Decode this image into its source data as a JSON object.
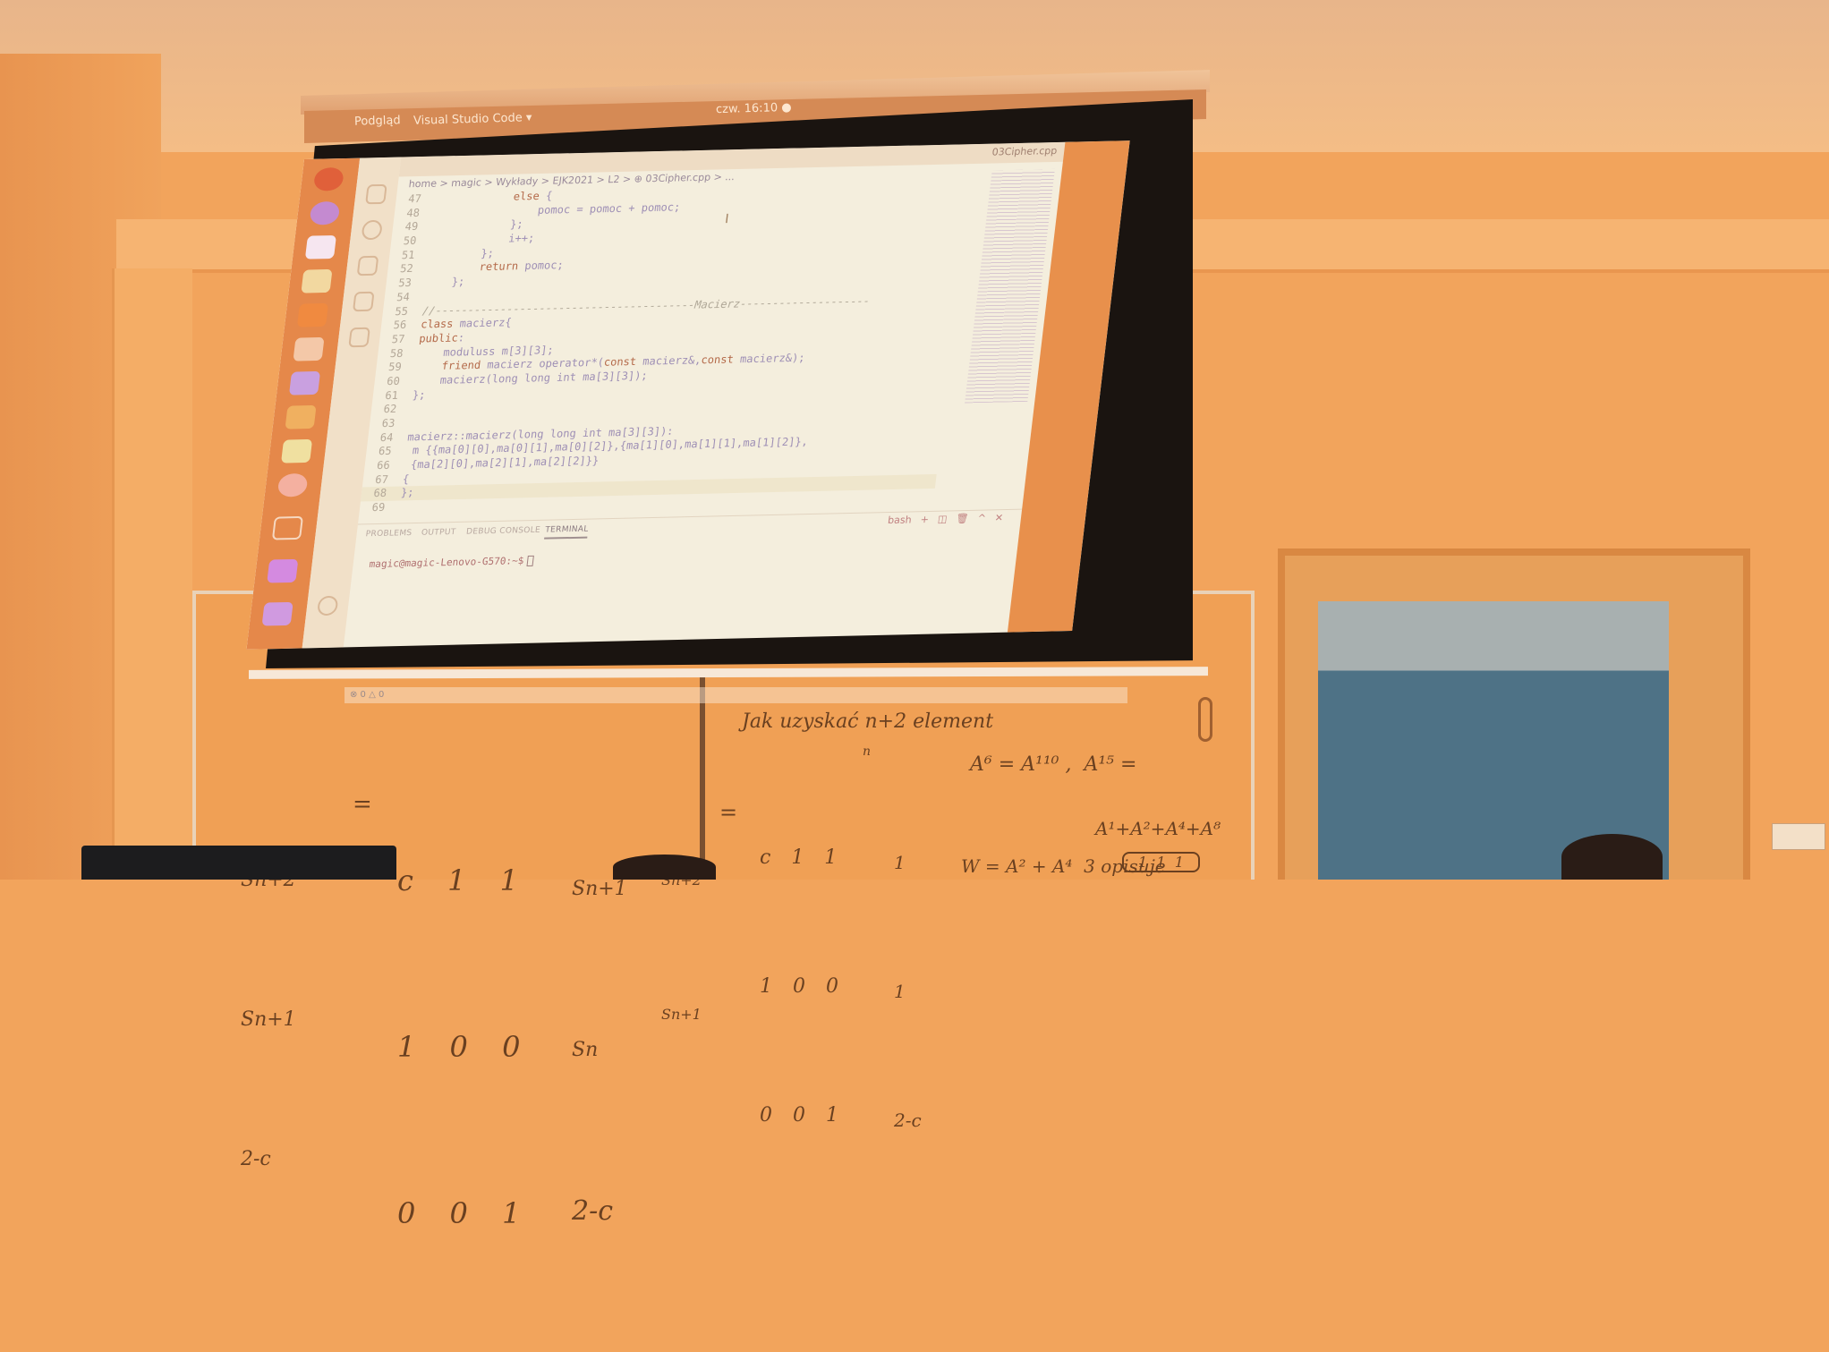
{
  "topbar": {
    "activities": "Podgląd",
    "app": "Visual Studio Code ▾",
    "clock": "czw. 16:10 ●"
  },
  "editor": {
    "tab_title": "03Cipher.cpp",
    "breadcrumb": "home > magic > Wykłady > EJK2021 > L2 > ⊕ 03Cipher.cpp > ...",
    "lines": [
      {
        "n": "47",
        "t": "            else {"
      },
      {
        "n": "48",
        "t": "                pomoc = pomoc + pomoc;"
      },
      {
        "n": "49",
        "t": "            };"
      },
      {
        "n": "50",
        "t": "            i++;"
      },
      {
        "n": "51",
        "t": "        };"
      },
      {
        "n": "52",
        "t": "        return pomoc;"
      },
      {
        "n": "53",
        "t": "    };"
      },
      {
        "n": "54",
        "t": ""
      },
      {
        "n": "55",
        "t": "//----------------------------------------Macierz--------------------"
      },
      {
        "n": "56",
        "t": "class macierz{"
      },
      {
        "n": "57",
        "t": "public:"
      },
      {
        "n": "58",
        "t": "    moduluss m[3][3];"
      },
      {
        "n": "59",
        "t": "    friend macierz operator*(const macierz&,const macierz&);"
      },
      {
        "n": "60",
        "t": "    macierz(long long int ma[3][3]);"
      },
      {
        "n": "61",
        "t": "};"
      },
      {
        "n": "62",
        "t": ""
      },
      {
        "n": "63",
        "t": ""
      },
      {
        "n": "64",
        "t": "macierz::macierz(long long int ma[3][3]):"
      },
      {
        "n": "65",
        "t": " m {{ma[0][0],ma[0][1],ma[0][2]},{ma[1][0],ma[1][1],ma[1][2]},"
      },
      {
        "n": "66",
        "t": " {ma[2][0],ma[2][1],ma[2][2]}}"
      },
      {
        "n": "67",
        "t": "{"
      },
      {
        "n": "68",
        "t": "};"
      },
      {
        "n": "69",
        "t": ""
      }
    ]
  },
  "panel": {
    "tabs": [
      "PROBLEMS",
      "OUTPUT",
      "DEBUG CONSOLE",
      "TERMINAL"
    ],
    "active_tab": "TERMINAL",
    "shell": "bash",
    "controls": {
      "add": "+",
      "split": "◫",
      "trash": "🗑",
      "maximize": "^",
      "close": "✕"
    },
    "prompt": "magic@magic-Lenovo-G570:~$"
  },
  "statusbar": {
    "problems": "⊗ 0 △ 0"
  },
  "whiteboard": {
    "heading": "Jak uzyskać n+2 element",
    "lhs_vector": [
      "Sn+2",
      "Sn+1",
      "2-c"
    ],
    "matrix": [
      "c 1 1",
      "1 0 0",
      "0 0 1"
    ],
    "rhs_vector": [
      "Sn+1",
      "Sn",
      "2-c"
    ],
    "second_vector": [
      "Sn+2",
      "Sn+1"
    ],
    "matrix_power": [
      "c 1 1",
      "1 0 0",
      "0 0 1"
    ],
    "exponent": "n",
    "init_vector": [
      "1",
      "1",
      "2-c"
    ],
    "note1": "A⁶ = A¹¹⁰ ,  A¹⁵ =",
    "note2": "A¹+A²+A⁴+A⁸",
    "note3": "W = A² + A⁴  3 opisuje",
    "note4": "1  1  1"
  },
  "colors": {
    "wall": "#f2a45c",
    "screen": "#f4eedd",
    "dock": "#e5884a",
    "keyword": "#b46a4a",
    "identifier": "#9e8fb5"
  }
}
